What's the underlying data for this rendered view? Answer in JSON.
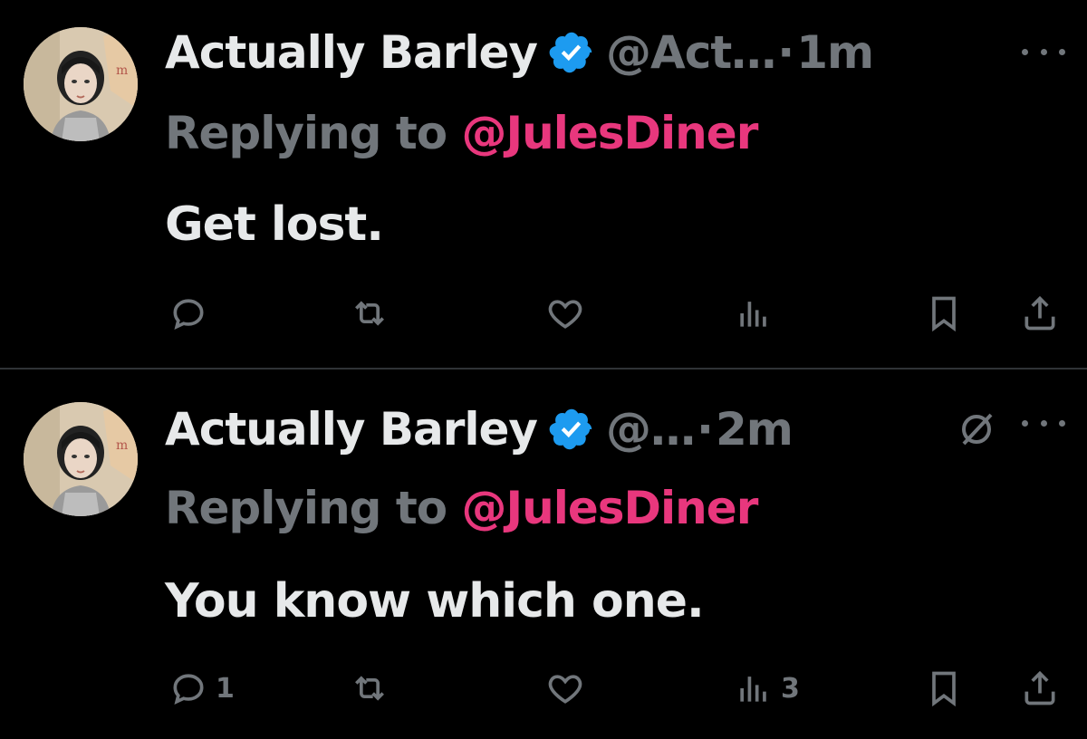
{
  "colors": {
    "background": "#000000",
    "text": "#e7e9ea",
    "muted": "#71767b",
    "mention": "#e8377d",
    "verified": "#1d9bf0",
    "divider": "#2f3336"
  },
  "tweets": [
    {
      "author_name": "Actually Barley",
      "handle": "@Act…",
      "separator": "·",
      "time": "1m",
      "replying_prefix": "Replying to ",
      "replying_to": "@JulesDiner",
      "text": "Get lost.",
      "icons": [
        "avatar",
        "verified-badge-icon",
        "more-icon",
        "reply-icon",
        "retweet-icon",
        "like-icon",
        "views-icon",
        "bookmark-icon",
        "share-icon"
      ],
      "counts": {
        "reply": "",
        "retweet": "",
        "like": "",
        "views": ""
      }
    },
    {
      "author_name": "Actually Barley",
      "handle": "@…",
      "separator": "·",
      "time": "2m",
      "replying_prefix": "Replying to ",
      "replying_to": "@JulesDiner",
      "text": "You know which one.",
      "icons": [
        "avatar",
        "verified-badge-icon",
        "grok-icon",
        "more-icon",
        "reply-icon",
        "retweet-icon",
        "like-icon",
        "views-icon",
        "bookmark-icon",
        "share-icon"
      ],
      "counts": {
        "reply": "1",
        "retweet": "",
        "like": "",
        "views": "3"
      }
    }
  ]
}
